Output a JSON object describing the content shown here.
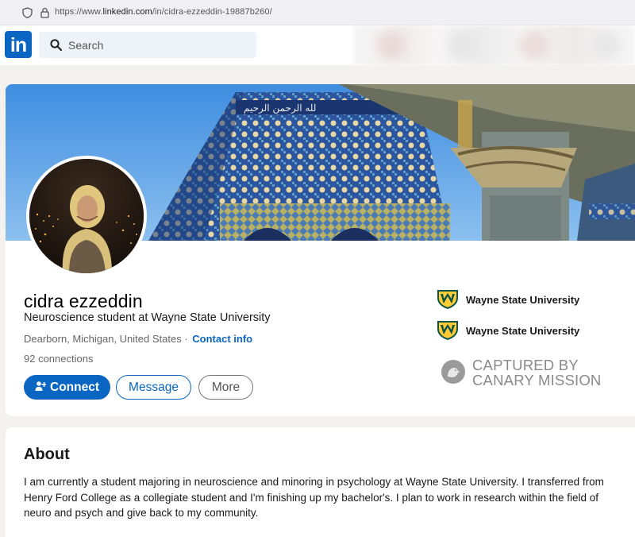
{
  "browser": {
    "url_prefix": "https://www.",
    "url_domain": "linkedin.com",
    "url_path": "/in/cidra-ezzeddin-19887b260/"
  },
  "nav": {
    "logo": "in",
    "search_placeholder": "Search"
  },
  "profile": {
    "name": "cidra ezzeddin",
    "headline": "Neuroscience student at Wayne State University",
    "location": "Dearborn, Michigan, United States",
    "location_separator": " · ",
    "contact_info": "Contact info",
    "connections": "92 connections",
    "actions": {
      "connect": "Connect",
      "message": "Message",
      "more": "More"
    },
    "education": [
      {
        "name": "Wayne State University"
      },
      {
        "name": "Wayne State University"
      }
    ]
  },
  "watermark": {
    "line1": "CAPTURED BY",
    "line2": "CANARY MISSION"
  },
  "about": {
    "title": "About",
    "text": "I am currently a student majoring in neuroscience and minoring in psychology at Wayne State University. I transferred from Henry Ford College as a collegiate student and I'm finishing up my bachelor's. I plan to work in research within the field of neuro and psych and give back to my community."
  },
  "colors": {
    "brand": "#0a66c2",
    "page_bg": "#f3f2ef",
    "wsu_green": "#0c5449",
    "wsu_gold": "#ffcc33"
  }
}
